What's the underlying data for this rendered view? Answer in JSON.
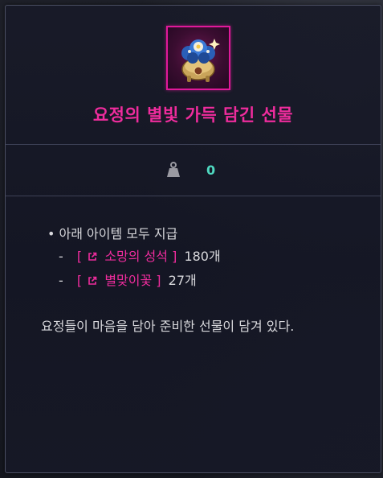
{
  "item": {
    "title": "요정의 별빛 가득 담긴 선물",
    "icon": "gift-pot-icon",
    "grade_color": "#ef2c9d"
  },
  "weight": {
    "icon": "weight-icon",
    "value": "0",
    "value_color": "#4fd8c0"
  },
  "contents": {
    "bullet": "•",
    "header": "아래 아이템 모두 지급",
    "rewards": [
      {
        "dash": "-",
        "open": "[",
        "icon": "external-link-icon",
        "name": "소망의 성석",
        "close": "]",
        "qty": "180개"
      },
      {
        "dash": "-",
        "open": "[",
        "icon": "external-link-icon",
        "name": "별맞이꽃",
        "close": "]",
        "qty": "27개"
      }
    ]
  },
  "flavor_text": "요정들이 마음을 담아 준비한 선물이 담겨 있다.",
  "colors": {
    "border": "#4a4e62",
    "link": "#ef2c9d",
    "text": "#d8d8dc"
  }
}
